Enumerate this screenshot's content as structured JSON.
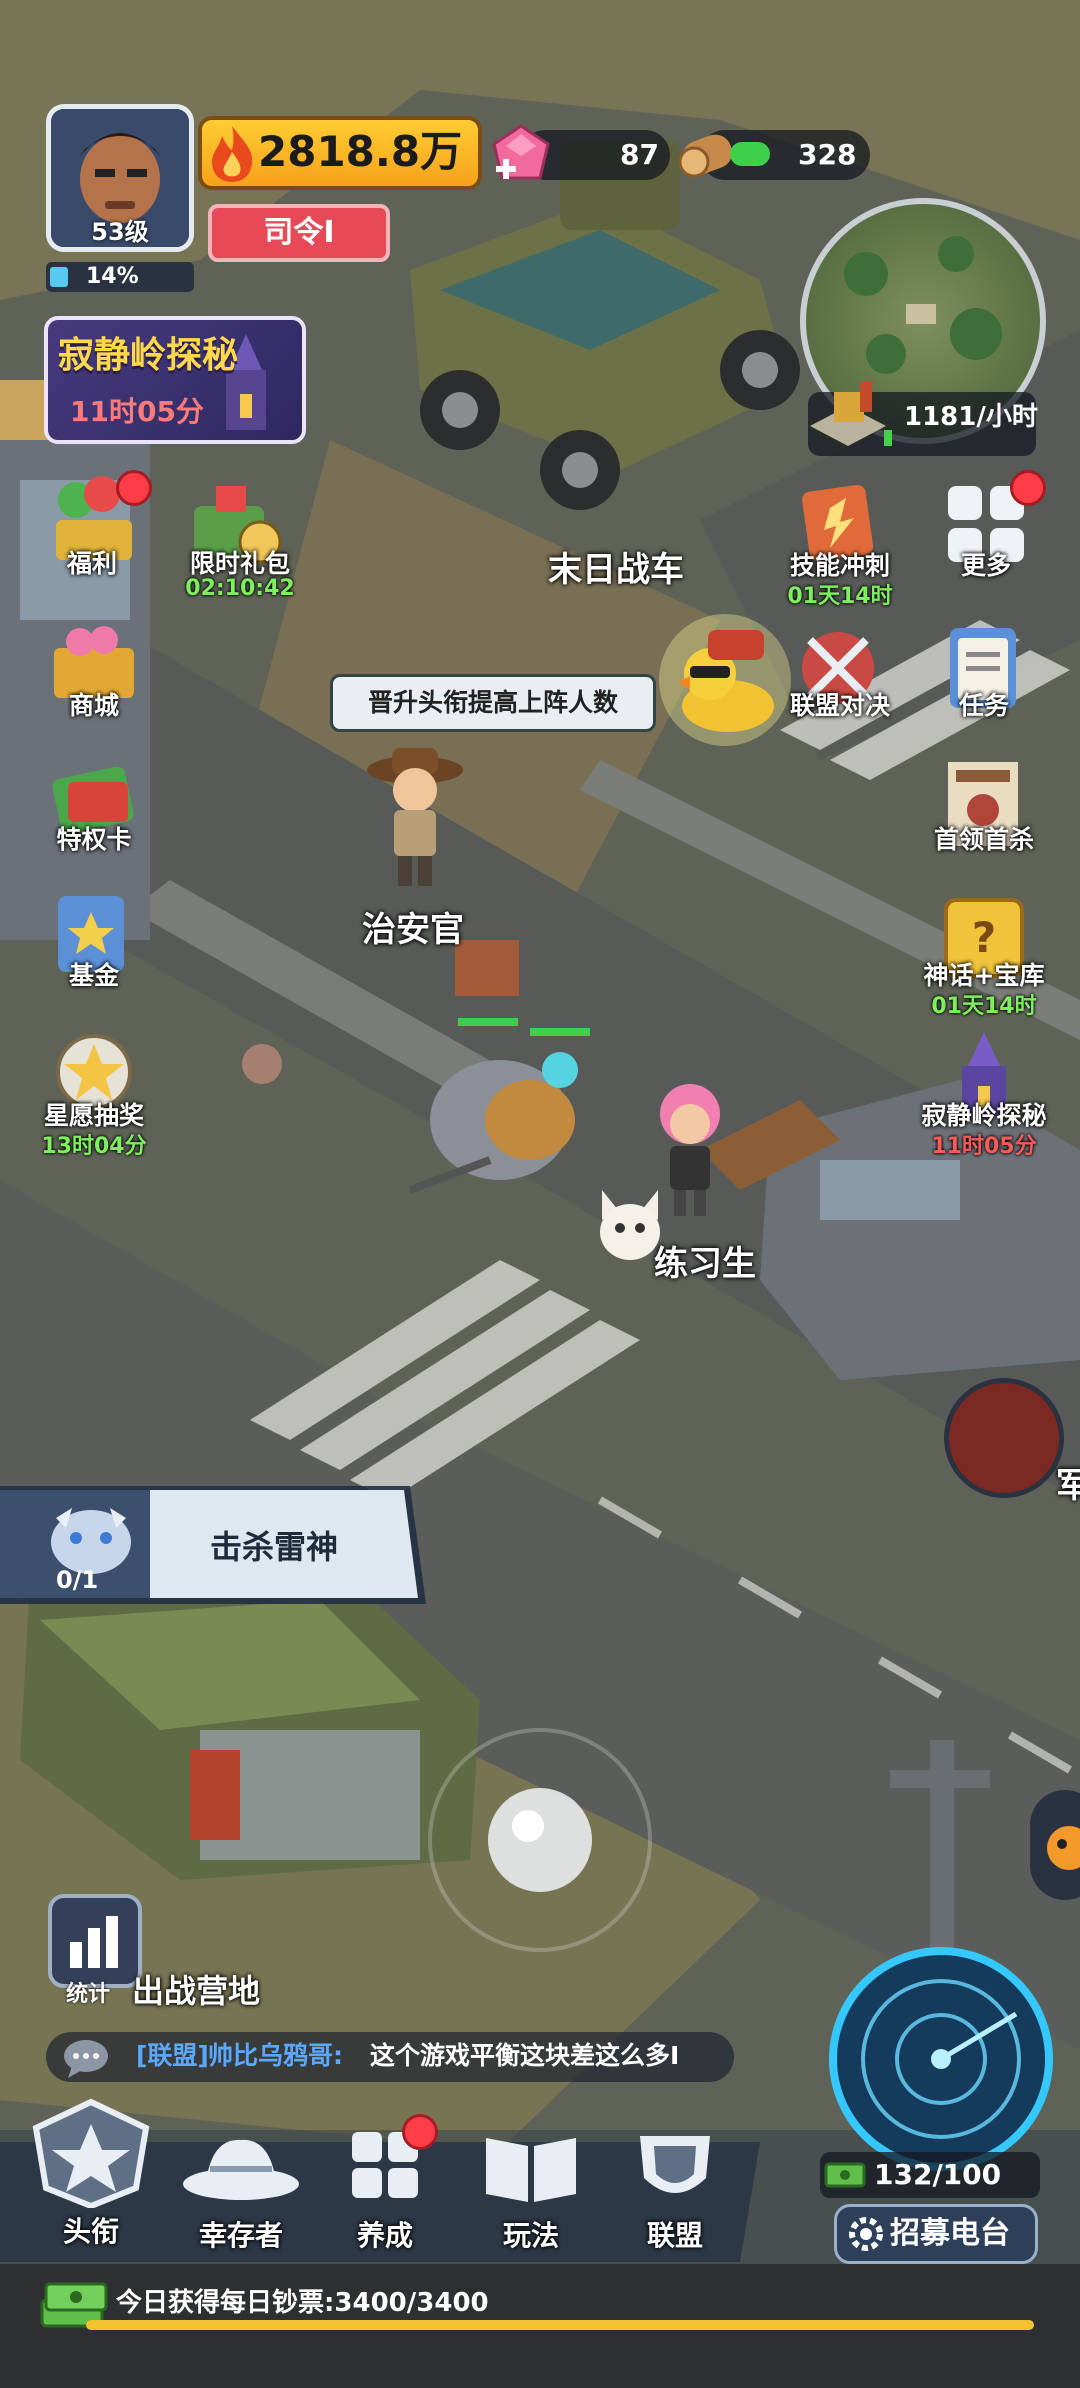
{
  "player": {
    "level": "53级",
    "exp_percent": "14%",
    "combat_power": "2818.8万",
    "rank_title": "司令I"
  },
  "resources": {
    "gems": "87",
    "wood": "328",
    "production_rate": "1181/小时"
  },
  "event_card": {
    "title": "寂静岭探秘",
    "timer": "11时05分"
  },
  "left_menu": [
    {
      "label": "福利",
      "timer": ""
    },
    {
      "label": "限时礼包",
      "timer": "02:10:42"
    },
    {
      "label": "商城",
      "timer": ""
    },
    {
      "label": "特权卡",
      "timer": ""
    },
    {
      "label": "基金",
      "timer": ""
    },
    {
      "label": "星愿抽奖",
      "timer": "13时04分"
    }
  ],
  "right_menu": [
    {
      "label": "技能冲刺",
      "timer": "01天14时"
    },
    {
      "label": "更多",
      "timer": ""
    },
    {
      "label": "联盟对决",
      "timer": ""
    },
    {
      "label": "任务",
      "timer": ""
    },
    {
      "label": "首领首杀",
      "timer": ""
    },
    {
      "label": "神话+宝库",
      "timer": "01天14时"
    },
    {
      "label": "寂静岭探秘",
      "timer": "11时05分"
    }
  ],
  "world": {
    "vehicle_label": "末日战车",
    "npc_label": "治安官",
    "npc_speech": "晋升头衔提高上阵人数",
    "trainee_label": "练习生",
    "edge_label": "军"
  },
  "quest": {
    "text": "击杀雷神",
    "progress": "0/1"
  },
  "camp": {
    "stats_label": "统计",
    "camp_label": "出战营地"
  },
  "chat": {
    "channel": "[联盟]",
    "sender": "帅比乌鸦哥:",
    "message": "这个游戏平衡这块差这么多I"
  },
  "bottom_nav": [
    "头衔",
    "幸存者",
    "养成",
    "玩法",
    "联盟"
  ],
  "radar": {
    "count": "132/100",
    "button": "招募电台"
  },
  "daily_money": {
    "text": "今日获得每日钞票:3400/3400",
    "progress": 1.0
  },
  "colors": {
    "power_gold": "#f7a21b",
    "rank_red": "#e74a57",
    "timer_green": "#7df05b",
    "timer_red": "#ff7a7a",
    "chat_blue": "#5aa8ff",
    "radar_cyan": "#35c8ff"
  }
}
